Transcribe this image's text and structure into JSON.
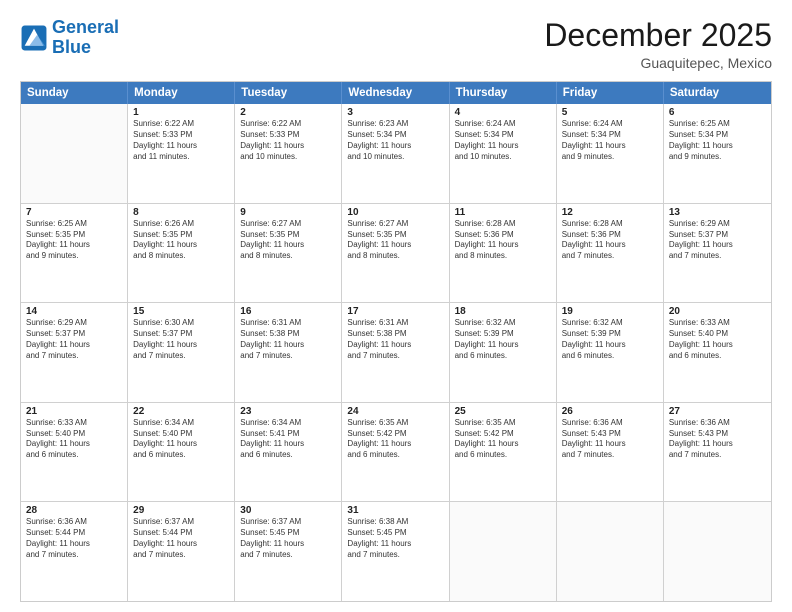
{
  "header": {
    "logo_line1": "General",
    "logo_line2": "Blue",
    "month": "December 2025",
    "location": "Guaquitepec, Mexico"
  },
  "calendar": {
    "days": [
      "Sunday",
      "Monday",
      "Tuesday",
      "Wednesday",
      "Thursday",
      "Friday",
      "Saturday"
    ],
    "rows": [
      [
        {
          "day": "",
          "text": ""
        },
        {
          "day": "1",
          "text": "Sunrise: 6:22 AM\nSunset: 5:33 PM\nDaylight: 11 hours\nand 11 minutes."
        },
        {
          "day": "2",
          "text": "Sunrise: 6:22 AM\nSunset: 5:33 PM\nDaylight: 11 hours\nand 10 minutes."
        },
        {
          "day": "3",
          "text": "Sunrise: 6:23 AM\nSunset: 5:34 PM\nDaylight: 11 hours\nand 10 minutes."
        },
        {
          "day": "4",
          "text": "Sunrise: 6:24 AM\nSunset: 5:34 PM\nDaylight: 11 hours\nand 10 minutes."
        },
        {
          "day": "5",
          "text": "Sunrise: 6:24 AM\nSunset: 5:34 PM\nDaylight: 11 hours\nand 9 minutes."
        },
        {
          "day": "6",
          "text": "Sunrise: 6:25 AM\nSunset: 5:34 PM\nDaylight: 11 hours\nand 9 minutes."
        }
      ],
      [
        {
          "day": "7",
          "text": "Sunrise: 6:25 AM\nSunset: 5:35 PM\nDaylight: 11 hours\nand 9 minutes."
        },
        {
          "day": "8",
          "text": "Sunrise: 6:26 AM\nSunset: 5:35 PM\nDaylight: 11 hours\nand 8 minutes."
        },
        {
          "day": "9",
          "text": "Sunrise: 6:27 AM\nSunset: 5:35 PM\nDaylight: 11 hours\nand 8 minutes."
        },
        {
          "day": "10",
          "text": "Sunrise: 6:27 AM\nSunset: 5:35 PM\nDaylight: 11 hours\nand 8 minutes."
        },
        {
          "day": "11",
          "text": "Sunrise: 6:28 AM\nSunset: 5:36 PM\nDaylight: 11 hours\nand 8 minutes."
        },
        {
          "day": "12",
          "text": "Sunrise: 6:28 AM\nSunset: 5:36 PM\nDaylight: 11 hours\nand 7 minutes."
        },
        {
          "day": "13",
          "text": "Sunrise: 6:29 AM\nSunset: 5:37 PM\nDaylight: 11 hours\nand 7 minutes."
        }
      ],
      [
        {
          "day": "14",
          "text": "Sunrise: 6:29 AM\nSunset: 5:37 PM\nDaylight: 11 hours\nand 7 minutes."
        },
        {
          "day": "15",
          "text": "Sunrise: 6:30 AM\nSunset: 5:37 PM\nDaylight: 11 hours\nand 7 minutes."
        },
        {
          "day": "16",
          "text": "Sunrise: 6:31 AM\nSunset: 5:38 PM\nDaylight: 11 hours\nand 7 minutes."
        },
        {
          "day": "17",
          "text": "Sunrise: 6:31 AM\nSunset: 5:38 PM\nDaylight: 11 hours\nand 7 minutes."
        },
        {
          "day": "18",
          "text": "Sunrise: 6:32 AM\nSunset: 5:39 PM\nDaylight: 11 hours\nand 6 minutes."
        },
        {
          "day": "19",
          "text": "Sunrise: 6:32 AM\nSunset: 5:39 PM\nDaylight: 11 hours\nand 6 minutes."
        },
        {
          "day": "20",
          "text": "Sunrise: 6:33 AM\nSunset: 5:40 PM\nDaylight: 11 hours\nand 6 minutes."
        }
      ],
      [
        {
          "day": "21",
          "text": "Sunrise: 6:33 AM\nSunset: 5:40 PM\nDaylight: 11 hours\nand 6 minutes."
        },
        {
          "day": "22",
          "text": "Sunrise: 6:34 AM\nSunset: 5:40 PM\nDaylight: 11 hours\nand 6 minutes."
        },
        {
          "day": "23",
          "text": "Sunrise: 6:34 AM\nSunset: 5:41 PM\nDaylight: 11 hours\nand 6 minutes."
        },
        {
          "day": "24",
          "text": "Sunrise: 6:35 AM\nSunset: 5:42 PM\nDaylight: 11 hours\nand 6 minutes."
        },
        {
          "day": "25",
          "text": "Sunrise: 6:35 AM\nSunset: 5:42 PM\nDaylight: 11 hours\nand 6 minutes."
        },
        {
          "day": "26",
          "text": "Sunrise: 6:36 AM\nSunset: 5:43 PM\nDaylight: 11 hours\nand 7 minutes."
        },
        {
          "day": "27",
          "text": "Sunrise: 6:36 AM\nSunset: 5:43 PM\nDaylight: 11 hours\nand 7 minutes."
        }
      ],
      [
        {
          "day": "28",
          "text": "Sunrise: 6:36 AM\nSunset: 5:44 PM\nDaylight: 11 hours\nand 7 minutes."
        },
        {
          "day": "29",
          "text": "Sunrise: 6:37 AM\nSunset: 5:44 PM\nDaylight: 11 hours\nand 7 minutes."
        },
        {
          "day": "30",
          "text": "Sunrise: 6:37 AM\nSunset: 5:45 PM\nDaylight: 11 hours\nand 7 minutes."
        },
        {
          "day": "31",
          "text": "Sunrise: 6:38 AM\nSunset: 5:45 PM\nDaylight: 11 hours\nand 7 minutes."
        },
        {
          "day": "",
          "text": ""
        },
        {
          "day": "",
          "text": ""
        },
        {
          "day": "",
          "text": ""
        }
      ]
    ]
  }
}
